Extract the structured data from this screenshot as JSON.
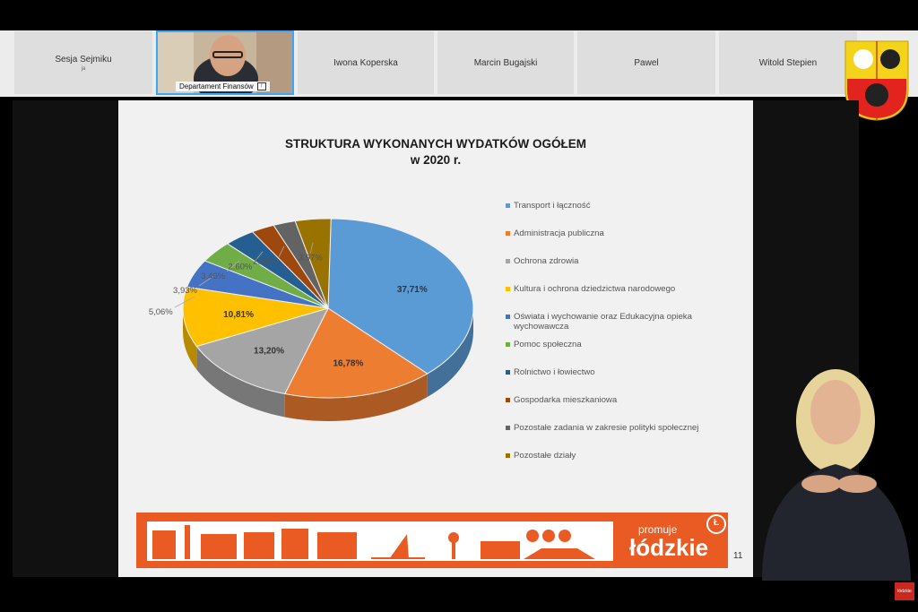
{
  "participants": [
    {
      "name": "Sesja Sejmiku",
      "sub": "ja"
    },
    {
      "name": "Departament Finansów",
      "has_video": true
    },
    {
      "name": "Iwona Koperska"
    },
    {
      "name": "Marcin Bugajski"
    },
    {
      "name": "Pawel"
    },
    {
      "name": "Witold Stepien"
    }
  ],
  "slide": {
    "title_line1": "STRUKTURA WYKONANYCH WYDATKÓW OGÓŁEM",
    "title_line2": "w 2020 r.",
    "page_number": "11"
  },
  "banner": {
    "line1": "promuje",
    "line2": "łódzkie",
    "logo_glyph": "Ł",
    "color": "#ea5b24"
  },
  "tv_badge": "łódzkie",
  "chart_data": {
    "type": "pie",
    "title": "STRUKTURA WYKONANYCH WYDATKÓW OGÓŁEM w 2020 r.",
    "legend_position": "right",
    "series": [
      {
        "name": "Transport i łączność",
        "value": 37.71,
        "label": "37,71%",
        "color": "#5b9bd5"
      },
      {
        "name": "Administracja publiczna",
        "value": 16.78,
        "label": "16,78%",
        "color": "#ed7d31"
      },
      {
        "name": "Ochrona zdrowia",
        "value": 13.2,
        "label": "13,20%",
        "color": "#a5a5a5"
      },
      {
        "name": "Kultura i ochrona dziedzictwa narodowego",
        "value": 10.81,
        "label": "10,81%",
        "color": "#ffc000"
      },
      {
        "name": "Oświata i wychowanie oraz Edukacyjna opieka wychowawcza",
        "value": 5.06,
        "label": "5,06%",
        "color": "#4472c4"
      },
      {
        "name": "Pomoc społeczna",
        "value": 3.93,
        "label": "3,93%",
        "color": "#70ad47"
      },
      {
        "name": "Rolnictwo i łowiectwo",
        "value": 3.46,
        "label": "3,46%",
        "color": "#255e91"
      },
      {
        "name": "Gospodarka mieszkaniowa",
        "value": 2.6,
        "label": "2,60%",
        "color": "#9e480e"
      },
      {
        "name": "Pozostałe zadania w zakresie polityki społecznej",
        "value": 2.48,
        "label": "2,48%",
        "color": "#636363"
      },
      {
        "name": "Pozostałe działy",
        "value": 3.97,
        "label": "3,97%",
        "color": "#997300"
      }
    ]
  }
}
